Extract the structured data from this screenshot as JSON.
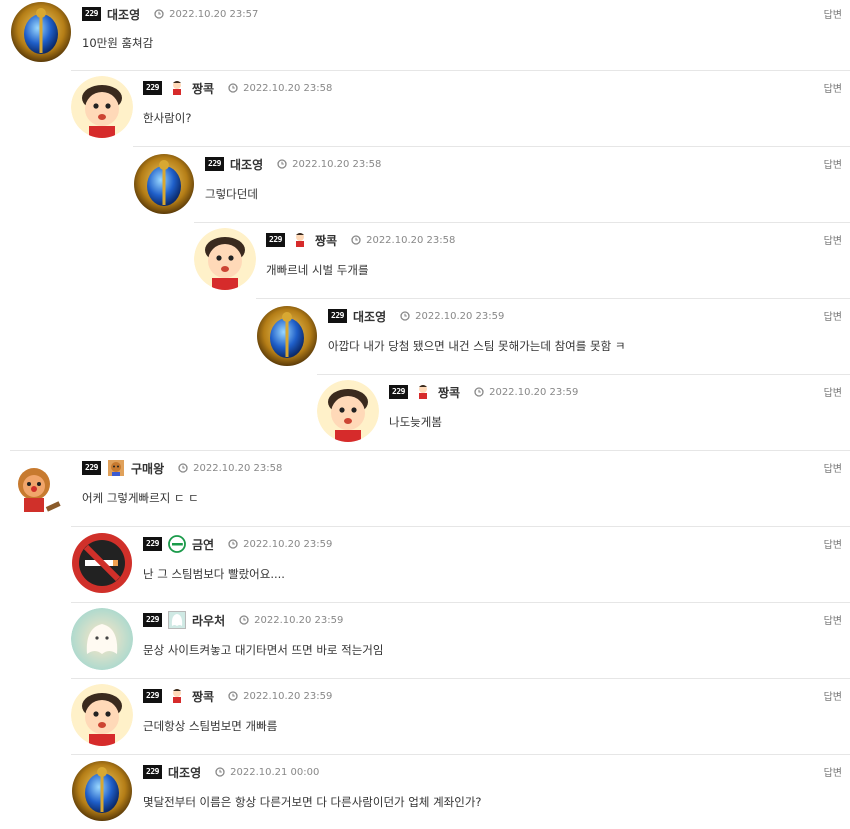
{
  "reply_label": "답변",
  "comments": [
    {
      "level": "229",
      "nick": "대조영",
      "date": "2022.10.20 23:57",
      "text": "10만원 훔쳐감",
      "avatar": "scarab-avatar",
      "icon": null
    },
    {
      "level": "229",
      "nick": "짱콕",
      "date": "2022.10.20 23:58",
      "text": "한사람이?",
      "avatar": "shinchan-avatar",
      "icon": "shinchan-icon"
    },
    {
      "level": "229",
      "nick": "대조영",
      "date": "2022.10.20 23:58",
      "text": "그렇다던데",
      "avatar": "scarab-avatar",
      "icon": null
    },
    {
      "level": "229",
      "nick": "짱콕",
      "date": "2022.10.20 23:58",
      "text": "개빠르네 시벌 두개를",
      "avatar": "shinchan-avatar",
      "icon": "shinchan-icon"
    },
    {
      "level": "229",
      "nick": "대조영",
      "date": "2022.10.20 23:59",
      "text": "아깝다 내가 당첨 됐으면 내건 스팀 못해가는데 참여를 못함 ㅋ",
      "avatar": "scarab-avatar",
      "icon": null
    },
    {
      "level": "229",
      "nick": "짱콕",
      "date": "2022.10.20 23:59",
      "text": "나도늦게봄",
      "avatar": "shinchan-avatar",
      "icon": "shinchan-icon"
    },
    {
      "level": "229",
      "nick": "구매왕",
      "date": "2022.10.20 23:58",
      "text": "어케 그렇게빠르지 ㄷ ㄷ",
      "avatar": "breadman-avatar",
      "icon": "breadman-icon"
    },
    {
      "level": "229",
      "nick": "금연",
      "date": "2022.10.20 23:59",
      "text": "난 그 스팀범보다 빨랐어요....",
      "avatar": "no-smoking-avatar",
      "icon": "no-smoking-icon"
    },
    {
      "level": "229",
      "nick": "라우처",
      "date": "2022.10.20 23:59",
      "text": "문상 사이트켜놓고 대기타면서 뜨면 바로 적는거임",
      "avatar": "ghost-avatar",
      "icon": "ghost-icon"
    },
    {
      "level": "229",
      "nick": "짱콕",
      "date": "2022.10.20 23:59",
      "text": "근데항상 스팀범보면 개빠름",
      "avatar": "shinchan-avatar",
      "icon": "shinchan-icon"
    },
    {
      "level": "229",
      "nick": "대조영",
      "date": "2022.10.21 00:00",
      "text": "몇달전부터 이름은 항상 다른거보면 다 다른사람이던가 업체 계좌인가?",
      "avatar": "scarab-avatar",
      "icon": null
    }
  ]
}
